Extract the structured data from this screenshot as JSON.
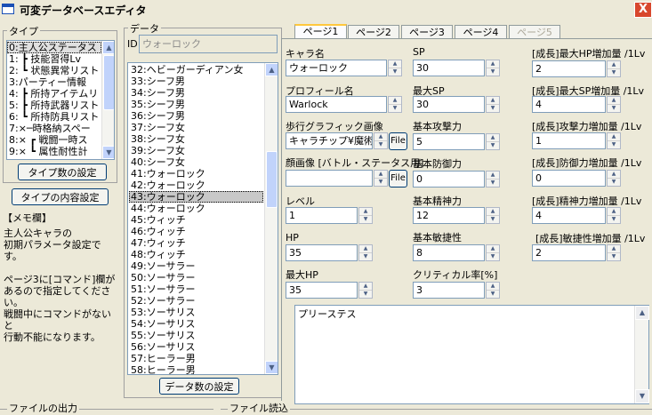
{
  "window": {
    "title": "可変データベースエディタ",
    "close_glyph": "X"
  },
  "type_panel": {
    "group_label": "タイプ",
    "items": [
      {
        "label": "0:主人公ステータス"
      },
      {
        "label": "1: ┣ 技能習得Lv"
      },
      {
        "label": "2: ┗ 状態異常リスト"
      },
      {
        "label": "3:パーティー情報"
      },
      {
        "label": "4: ┣ 所持アイテムリ"
      },
      {
        "label": "5: ┣ 所持武器リスト"
      },
      {
        "label": "6: ┗ 所持防具リスト"
      },
      {
        "label": "7:×─時格納スペー"
      },
      {
        "label": "8:× ┏ 戦闘一時ス"
      },
      {
        "label": "9:× ┗ 属性耐性計"
      }
    ],
    "count_button": "タイプ数の設定",
    "content_button": "タイプの内容設定"
  },
  "memo": {
    "label": "【メモ欄】",
    "text": "主人公キャラの\n初期パラメータ設定です。\n\nページ3に[コマンド]欄が\nあるので指定してください。\n戦闘中にコマンドがないと\n行動不能になります。"
  },
  "data_panel": {
    "group_label": "データ",
    "id_label": "ID",
    "id_value": "ウォーロック",
    "items": [
      {
        "label": "32:ヘビーガーディアン女"
      },
      {
        "label": "33:シーフ男"
      },
      {
        "label": "34:シーフ男"
      },
      {
        "label": "35:シーフ男"
      },
      {
        "label": "36:シーフ男"
      },
      {
        "label": "37:シーフ女"
      },
      {
        "label": "38:シーフ女"
      },
      {
        "label": "39:シーフ女"
      },
      {
        "label": "40:シーフ女"
      },
      {
        "label": "41:ウォーロック"
      },
      {
        "label": "42:ウォーロック"
      },
      {
        "label": "43:ウォーロック"
      },
      {
        "label": "44:ウォーロック"
      },
      {
        "label": "45:ウィッチ"
      },
      {
        "label": "46:ウィッチ"
      },
      {
        "label": "47:ウィッチ"
      },
      {
        "label": "48:ウィッチ"
      },
      {
        "label": "49:ソーサラー"
      },
      {
        "label": "50:ソーサラー"
      },
      {
        "label": "51:ソーサラー"
      },
      {
        "label": "52:ソーサラー"
      },
      {
        "label": "53:ソーサリス"
      },
      {
        "label": "54:ソーサリス"
      },
      {
        "label": "55:ソーサリス"
      },
      {
        "label": "56:ソーサリス"
      },
      {
        "label": "57:ヒーラー男"
      },
      {
        "label": "58:ヒーラー男"
      }
    ],
    "count_button": "データ数の設定"
  },
  "tabs": [
    {
      "label": "ページ1"
    },
    {
      "label": "ページ2"
    },
    {
      "label": "ページ3"
    },
    {
      "label": "ページ4"
    },
    {
      "label": "ページ5"
    }
  ],
  "fields": {
    "chara_name": {
      "label": "キャラ名",
      "value": "ウォーロック"
    },
    "profile_name": {
      "label": "プロフィール名",
      "value": "Warlock"
    },
    "walk_graphic": {
      "label": "歩行グラフィック画像",
      "value": "キャラチップ¥魔術師"
    },
    "face_image": {
      "label": "顔画像 [バトル・ステータス用]",
      "value": ""
    },
    "level": {
      "label": "レベル",
      "value": "1"
    },
    "hp": {
      "label": "HP",
      "value": "35"
    },
    "max_hp": {
      "label": "最大HP",
      "value": "35"
    },
    "sp": {
      "label": "SP",
      "value": "30"
    },
    "max_sp": {
      "label": "最大SP",
      "value": "30"
    },
    "attack": {
      "label": "基本攻撃力",
      "value": "5"
    },
    "defense": {
      "label": "基本防御力",
      "value": "0"
    },
    "spirit": {
      "label": "基本精神力",
      "value": "12"
    },
    "agility": {
      "label": "基本敏捷性",
      "value": "8"
    },
    "critical": {
      "label": "クリティカル率[%]",
      "value": "3"
    },
    "grow_max_hp": {
      "label": "[成長]最大HP増加量 /1Lv",
      "value": "2"
    },
    "grow_max_sp": {
      "label": "[成長]最大SP増加量 /1Lv",
      "value": "4"
    },
    "grow_attack": {
      "label": "[成長]攻撃力増加量 /1Lv",
      "value": "1"
    },
    "grow_defense": {
      "label": "[成長]防御力増加量 /1Lv",
      "value": "0"
    },
    "grow_spirit": {
      "label": "[成長]精神力増加量 /1Lv",
      "value": "4"
    },
    "grow_agility": {
      "label": "[成長]敏捷性増加量 /1Lv",
      "value": "2"
    }
  },
  "file_button": "File",
  "description_text": "プリーステス",
  "bottom": {
    "output_label": "ファイルの出力",
    "import_label": "ファイル読込"
  }
}
